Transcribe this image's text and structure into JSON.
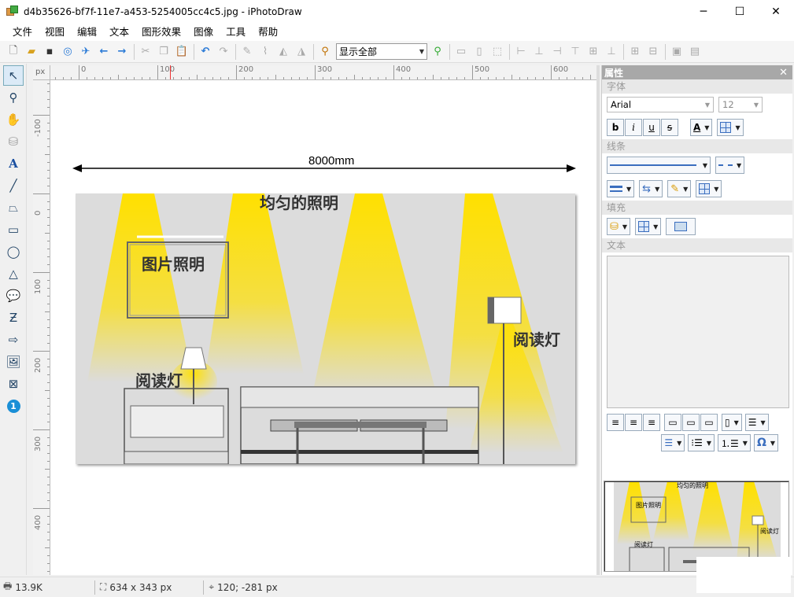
{
  "window": {
    "title": "d4b35626-bf7f-11e7-a453-5254005cc4c5.jpg - iPhotoDraw",
    "minimize": "─",
    "maximize": "☐",
    "close": "✕"
  },
  "menu": [
    "文件",
    "视图",
    "编辑",
    "文本",
    "图形效果",
    "图像",
    "工具",
    "帮助"
  ],
  "toolbar": {
    "zoom_value": "显示全部"
  },
  "ruler": {
    "unit": "px",
    "h_labels": [
      "0",
      "100",
      "200",
      "300",
      "400",
      "500",
      "600"
    ],
    "v_labels": [
      "-100",
      "0",
      "100",
      "200",
      "300",
      "400"
    ]
  },
  "canvas": {
    "dimension_label": "8000mm",
    "photo_labels": {
      "uniform": "均匀的照明",
      "picture": "图片照明",
      "reading_left": "阅读灯",
      "reading_right": "阅读灯"
    }
  },
  "panel": {
    "title": "属性",
    "close": "✕",
    "font_section": "字体",
    "font_name": "Arial",
    "font_size": "12",
    "bold": "b",
    "italic": "i",
    "underline": "u",
    "strike": "s",
    "font_color_glyph": "A",
    "line_section": "线条",
    "fill_section": "填充",
    "text_section": "文本",
    "omega": "Ω"
  },
  "thumbnail": {
    "uniform": "均匀的照明",
    "picture": "图片照明",
    "reading_left": "阅读灯",
    "reading_right": "阅读灯"
  },
  "status": {
    "file_size": "13.9K",
    "dimensions": "634 x 343 px",
    "cursor": "120; -281 px"
  },
  "colors": {
    "light_yellow": "#ffe000",
    "panel_header": "#a8a8a8",
    "accent_blue": "#2a7ad6"
  }
}
